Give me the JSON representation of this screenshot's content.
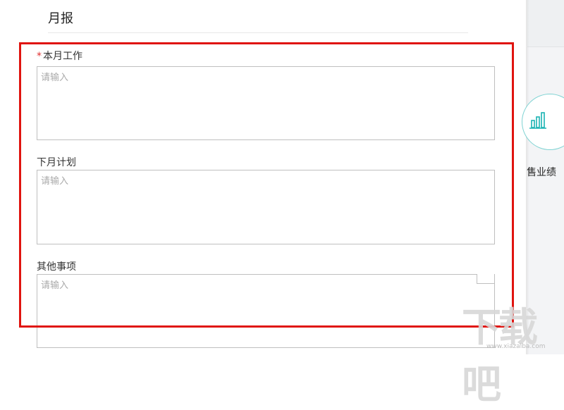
{
  "form": {
    "title": "月报",
    "fields": [
      {
        "label": "本月工作",
        "required": true,
        "required_mark": "*",
        "placeholder": "请输入"
      },
      {
        "label": "下月计划",
        "required": false,
        "placeholder": "请输入"
      },
      {
        "label": "其他事项",
        "required": false,
        "placeholder": "请输入"
      }
    ]
  },
  "right_panel": {
    "icon": "bar-chart-icon",
    "label": "售业绩"
  },
  "watermark": {
    "logo_text": "下载吧",
    "site": "www.xiazaiba.com"
  },
  "colors": {
    "highlight": "#e0140f",
    "required": "#e03030",
    "icon_accent": "#1ab3b3"
  }
}
